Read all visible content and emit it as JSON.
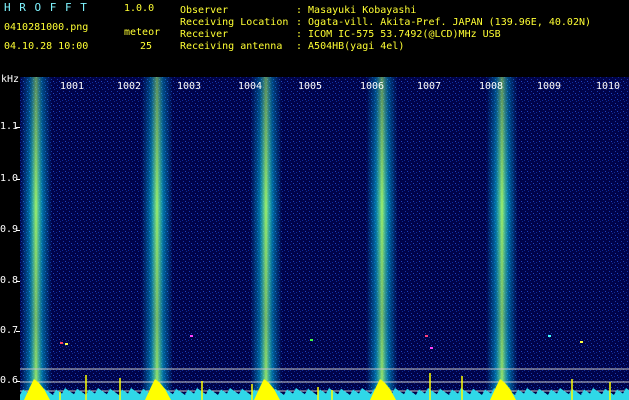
{
  "header": {
    "app_name": "H R O F F T",
    "version": "1.0.0",
    "filename": "0410281000.png",
    "datetime": "04.10.28 10:00",
    "meteor_label": "meteor",
    "meteor_count": "25"
  },
  "info": [
    {
      "label": "Observer",
      "value": ": Masayuki Kobayashi"
    },
    {
      "label": "Receiving Location",
      "value": ": Ogata-vill. Akita-Pref. JAPAN (139.96E, 40.02N)"
    },
    {
      "label": "Receiver",
      "value": ": ICOM IC-575 53.7492(@LCD)MHz USB"
    },
    {
      "label": "Receiving antenna",
      "value": ": A504HB(yagi 4el)"
    }
  ],
  "plot": {
    "ylabel": "kHz",
    "colors": {
      "background": "#00034a",
      "signal": "#2fffd0",
      "hot": "#ffff00",
      "guide": "#c8c8c8"
    },
    "y_ticks": [
      "1.1",
      "1.0",
      "0.9",
      "0.8",
      "0.7",
      "0.6"
    ],
    "x_labels": [
      "1001",
      "1002",
      "1003",
      "1004",
      "1005",
      "1006",
      "1007",
      "1008",
      "1009",
      "1010"
    ],
    "stripes_at_minutes": [
      1001,
      1003,
      1005,
      1007,
      1009
    ]
  }
}
